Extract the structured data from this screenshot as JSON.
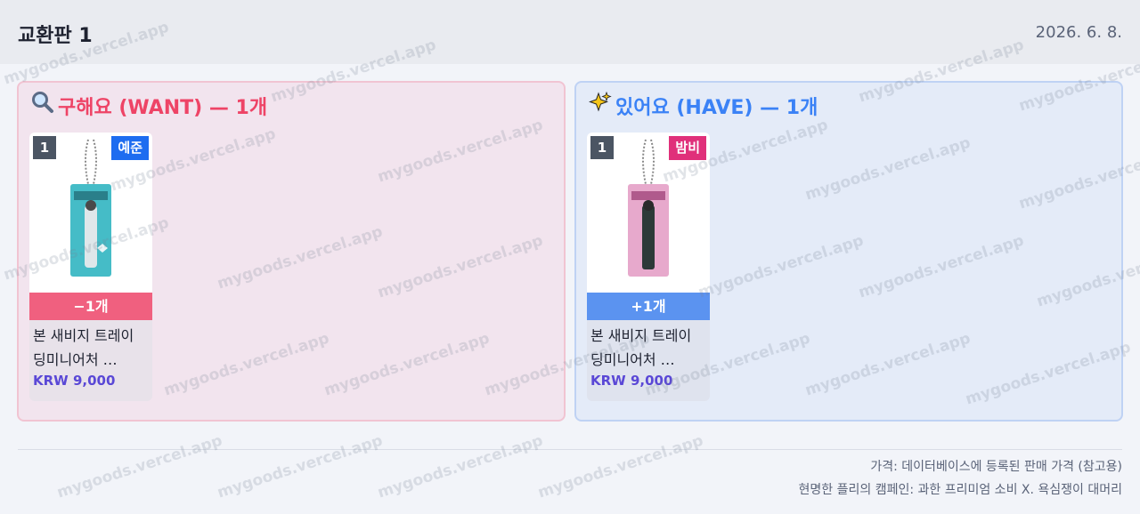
{
  "header": {
    "title": "교환판 1",
    "date": "2026. 6. 8."
  },
  "want_panel": {
    "icon": "magnifier-icon",
    "title": "구해요 (WANT) — 1개",
    "cards": [
      {
        "qty": "1",
        "member": "예준",
        "member_color": "#1d6cf0",
        "delta": "−1개",
        "name_line1": "본 새비지 트레이",
        "name_line2": "딩미니어처 …",
        "price": "KRW 9,000"
      }
    ]
  },
  "have_panel": {
    "icon": "sparkles-icon",
    "title": "있어요 (HAVE) — 1개",
    "cards": [
      {
        "qty": "1",
        "member": "밤비",
        "member_color": "#e0307a",
        "delta": "+1개",
        "name_line1": "본 새비지 트레이",
        "name_line2": "딩미니어처 …",
        "price": "KRW 9,000"
      }
    ]
  },
  "footer": {
    "line1": "가격: 데이터베이스에 등록된 판매 가격 (참고용)",
    "line2": "현명한 플리의 캠페인: 과한 프리미엄 소비 X. 욕심쟁이 대머리"
  },
  "watermark": "mygoods.vercel.app",
  "colors": {
    "want_accent": "#ee4466",
    "have_accent": "#3b82f6",
    "price": "#5a48d6"
  }
}
